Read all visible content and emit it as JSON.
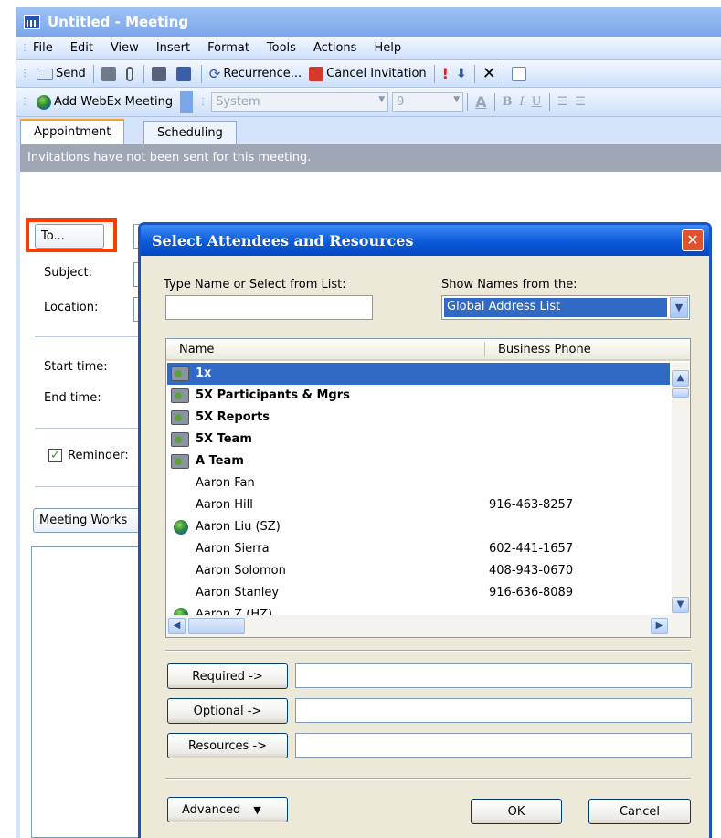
{
  "window": {
    "title": "Untitled - Meeting",
    "menus": [
      "File",
      "Edit",
      "View",
      "Insert",
      "Format",
      "Tools",
      "Actions",
      "Help"
    ],
    "toolbar1": {
      "send": "Send",
      "recurrence": "Recurrence...",
      "cancel_invitation": "Cancel Invitation"
    },
    "toolbar2": {
      "webex": "Add WebEx Meeting",
      "font": "System",
      "font_size": "9"
    },
    "tabs": [
      "Appointment",
      "Scheduling"
    ],
    "infobar": "Invitations have not been sent for this meeting.",
    "form": {
      "to_button": "To...",
      "subject_label": "Subject:",
      "location_label": "Location:",
      "start_label": "Start time:",
      "end_label": "End time:",
      "reminder_label": "Reminder:",
      "workspace_button": "Meeting Works"
    }
  },
  "dialog": {
    "title": "Select Attendees and Resources",
    "type_label": "Type Name or Select from List:",
    "show_label": "Show Names from the:",
    "address_book": "Global Address List",
    "columns": [
      "Name",
      "Business Phone"
    ],
    "rows": [
      {
        "name": "1x",
        "phone": "",
        "icon": "group-icon",
        "bold": true,
        "selected": true
      },
      {
        "name": "5X Participants & Mgrs",
        "phone": "",
        "icon": "group-icon",
        "bold": true,
        "selected": false
      },
      {
        "name": "5X Reports",
        "phone": "",
        "icon": "group-icon",
        "bold": true,
        "selected": false
      },
      {
        "name": "5X Team",
        "phone": "",
        "icon": "group-icon",
        "bold": true,
        "selected": false
      },
      {
        "name": "A Team",
        "phone": "",
        "icon": "group-icon",
        "bold": true,
        "selected": false
      },
      {
        "name": "Aaron Fan",
        "phone": "",
        "icon": "",
        "bold": false,
        "selected": false
      },
      {
        "name": "Aaron Hill",
        "phone": "916-463-8257",
        "icon": "",
        "bold": false,
        "selected": false
      },
      {
        "name": "Aaron Liu (SZ)",
        "phone": "",
        "icon": "globe-icon",
        "bold": false,
        "selected": false
      },
      {
        "name": "Aaron Sierra",
        "phone": "602-441-1657",
        "icon": "",
        "bold": false,
        "selected": false
      },
      {
        "name": "Aaron Solomon",
        "phone": "408-943-0670",
        "icon": "",
        "bold": false,
        "selected": false
      },
      {
        "name": "Aaron Stanley",
        "phone": "916-636-8089",
        "icon": "",
        "bold": false,
        "selected": false
      },
      {
        "name": "Aaron Z (HZ)",
        "phone": "",
        "icon": "globe-icon",
        "bold": false,
        "selected": false
      }
    ],
    "required_button": "Required ->",
    "optional_button": "Optional ->",
    "resources_button": "Resources ->",
    "advanced_button": "Advanced",
    "ok_button": "OK",
    "cancel_button": "Cancel"
  }
}
